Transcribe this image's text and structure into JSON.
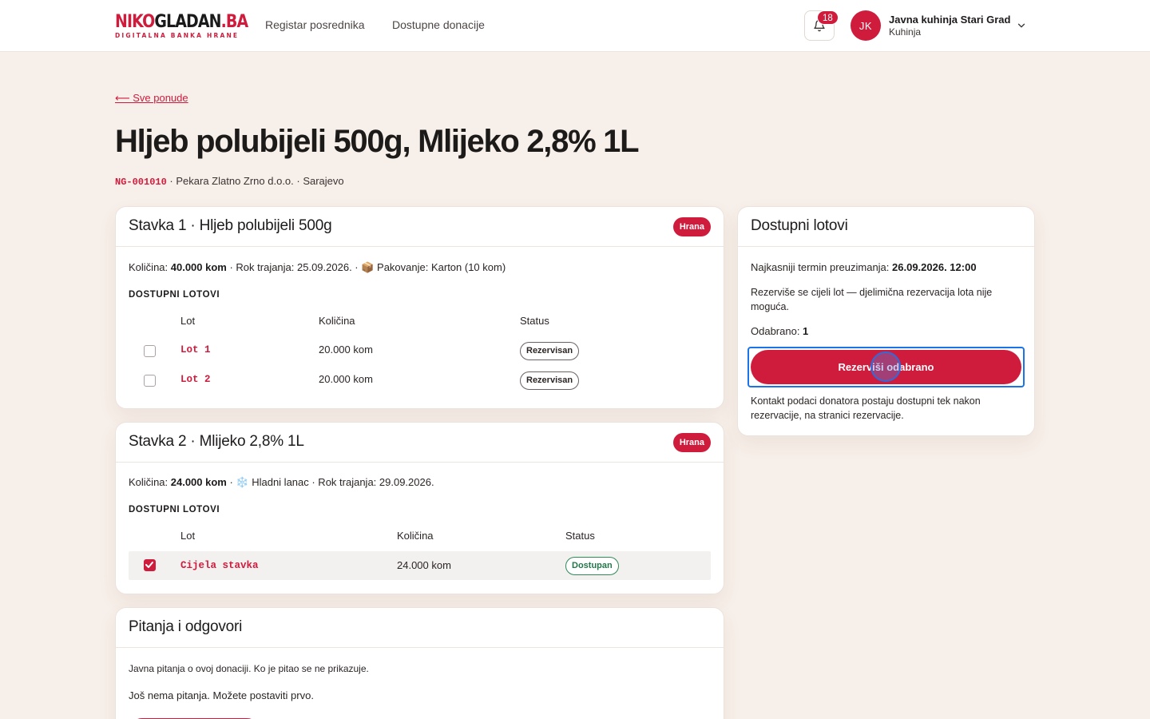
{
  "header": {
    "logo_part1": "NIKO",
    "logo_part2": "GLADAN",
    "logo_part3": ".BA",
    "logo_tagline": "DIGITALNA BANKA HRANE",
    "nav": [
      "Registar posrednika",
      "Dostupne donacije"
    ],
    "notifications_count": "18",
    "user": {
      "initials": "JK",
      "name": "Javna kuhinja Stari Grad",
      "role": "Kuhinja"
    }
  },
  "page": {
    "back_link": "⟵ Sve ponude",
    "title": "Hljeb polubijeli 500g, Mlijeko 2,8% 1L",
    "code": "NG-001010",
    "meta_rest": " · Pekara Zlatno Zrno d.o.o. · Sarajevo"
  },
  "items": [
    {
      "title": "Stavka 1 · Hljeb polubijeli 500g",
      "category": "Hrana",
      "qty_label": "Količina: ",
      "qty_value": "40.000 kom",
      "details": " · Rok trajanja: 25.09.2026. · 📦 Pakovanje: Karton (10 kom)",
      "lots_label": "DOSTUPNI LOTOVI",
      "columns": [
        "Lot",
        "Količina",
        "Status"
      ],
      "rows": [
        {
          "lot": "Lot 1",
          "qty": "20.000 kom",
          "status": "Rezervisan",
          "checked": false
        },
        {
          "lot": "Lot 2",
          "qty": "20.000 kom",
          "status": "Rezervisan",
          "checked": false
        }
      ]
    },
    {
      "title": "Stavka 2 · Mlijeko 2,8% 1L",
      "category": "Hrana",
      "qty_label": "Količina: ",
      "qty_value": "24.000 kom",
      "details": " · ❄️ Hladni lanac · Rok trajanja: 29.09.2026.",
      "lots_label": "DOSTUPNI LOTOVI",
      "columns": [
        "Lot",
        "Količina",
        "Status"
      ],
      "rows": [
        {
          "lot": "Cijela stavka",
          "qty": "24.000 kom",
          "status": "Dostupan",
          "checked": true
        }
      ]
    }
  ],
  "qa": {
    "title": "Pitanja i odgovori",
    "intro": "Javna pitanja o ovoj donaciji. Ko je pitao se ne prikazuje.",
    "empty": "Još nema pitanja. Možete postaviti prvo."
  },
  "sidebar": {
    "title": "Dostupni lotovi",
    "deadline_label": "Najkasniji termin preuzimanja: ",
    "deadline_value": "26.09.2026. 12:00",
    "note": "Rezerviše se cijeli lot — djelimična rezervacija lota nije moguća.",
    "selected_label": "Odabrano: ",
    "selected_value": "1",
    "cta": "Rezerviši odabrano",
    "contact_note": "Kontakt podaci donatora postaju dostupni tek nakon rezervacije, na stranici rezervacije."
  },
  "colors": {
    "brand": "#cf1c3d",
    "success": "#21784a",
    "background": "#f7efe9"
  }
}
